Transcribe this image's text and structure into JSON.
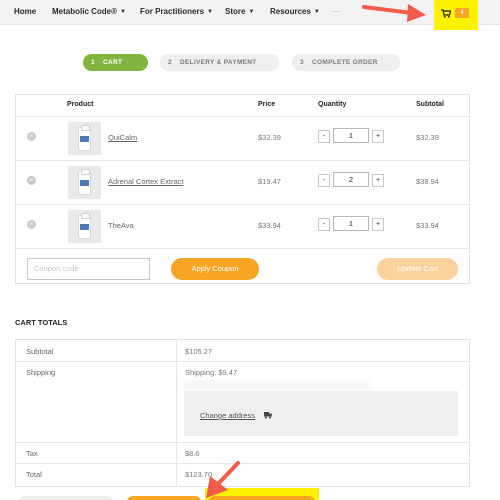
{
  "nav": {
    "items": [
      {
        "label": "Home",
        "has_caret": false
      },
      {
        "label": "Metabolic Code®",
        "has_caret": true
      },
      {
        "label": "For Practitioners",
        "has_caret": true
      },
      {
        "label": "Store",
        "has_caret": true
      },
      {
        "label": "Resources",
        "has_caret": true
      }
    ],
    "more": "···",
    "cart_count": "4",
    "cart_icon": "shopping-cart-icon"
  },
  "steps": [
    {
      "num": "1",
      "label": "CART",
      "active": true
    },
    {
      "num": "2",
      "label": "DELIVERY & PAYMENT",
      "active": false
    },
    {
      "num": "3",
      "label": "COMPLETE ORDER",
      "active": false
    }
  ],
  "cart": {
    "headers": {
      "product": "Product",
      "price": "Price",
      "quantity": "Quantity",
      "subtotal": "Subtotal"
    },
    "rows": [
      {
        "name": "QuiCalm",
        "price": "$32.39",
        "qty": "1",
        "subtotal": "$32.39"
      },
      {
        "name": "Adrenal Cortex Extract",
        "price": "$19.47",
        "qty": "2",
        "subtotal": "$38.94"
      },
      {
        "name": "TheAva",
        "price": "$33.94",
        "qty": "1",
        "subtotal": "$33.94"
      }
    ],
    "remove_symbol": "×",
    "minus": "-",
    "plus": "+",
    "coupon_placeholder": "Coupon code",
    "apply_coupon": "Apply Coupon",
    "update_cart": "Update Cart"
  },
  "totals": {
    "title": "CART TOTALS",
    "subtotal_label": "Subtotal",
    "subtotal_value": "$105.27",
    "shipping_label": "Shipping",
    "shipping_value": "Shipping: $9.47",
    "change_address": "Change address",
    "tax_label": "Tax",
    "tax_value": "$8.6",
    "total_label": "Total",
    "total_value": "$123.70"
  },
  "colors": {
    "accent_green": "#82b440",
    "accent_orange": "#f7a623",
    "highlight_yellow": "#fff200",
    "arrow_red": "#f25a4a"
  }
}
